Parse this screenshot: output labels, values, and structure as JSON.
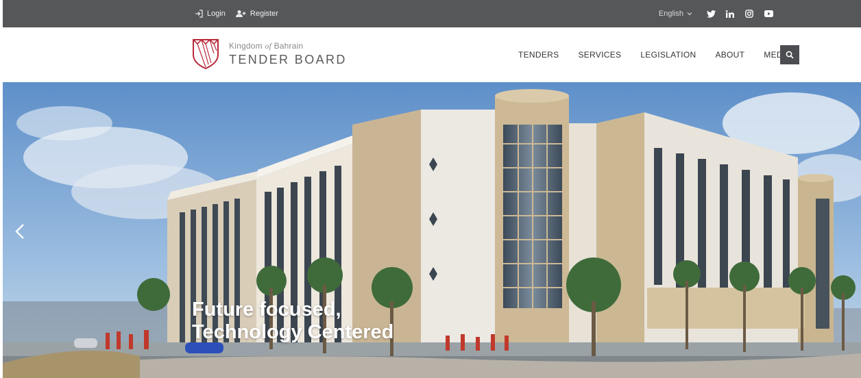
{
  "topbar": {
    "login": "Login",
    "register": "Register",
    "language": "English",
    "social": [
      "twitter-icon",
      "linkedin-icon",
      "instagram-icon",
      "youtube-icon"
    ]
  },
  "header": {
    "logo_prefix": "Kingdom",
    "logo_of": "of",
    "logo_suffix": "Bahrain",
    "logo_main": "TENDER BOARD",
    "nav": [
      {
        "label": "TENDERS"
      },
      {
        "label": "SERVICES"
      },
      {
        "label": "LEGISLATION"
      },
      {
        "label": "ABOUT"
      },
      {
        "label": "MEDIA"
      }
    ]
  },
  "hero": {
    "caption_line1": "Future focused,",
    "caption_line2": "Technology Centered"
  },
  "colors": {
    "topbar": "#555759",
    "logo_red": "#b8293a",
    "search_btn": "#4b4d50"
  }
}
